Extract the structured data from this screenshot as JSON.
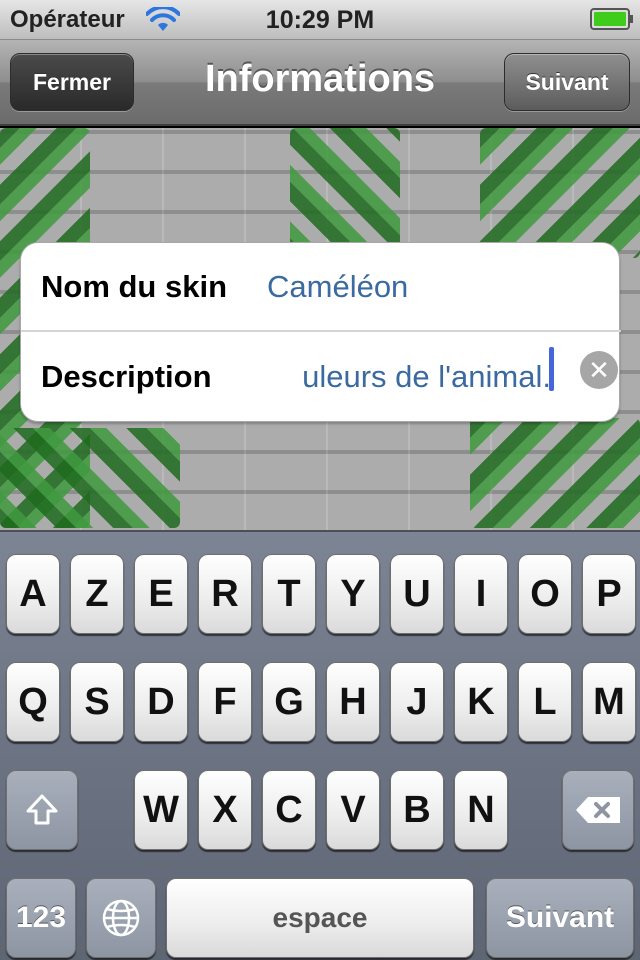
{
  "status_bar": {
    "carrier": "Opérateur",
    "time": "10:29 PM",
    "wifi_icon": "wifi-icon",
    "battery_icon": "battery-icon"
  },
  "nav": {
    "title": "Informations",
    "left_button": "Fermer",
    "right_button": "Suivant"
  },
  "form": {
    "rows": [
      {
        "label": "Nom du skin",
        "value": "Caméléon"
      },
      {
        "label": "Description",
        "value": "uleurs de l'animal.",
        "clear_icon": "clear-circle-icon"
      }
    ]
  },
  "keyboard": {
    "row1": [
      "A",
      "Z",
      "E",
      "R",
      "T",
      "Y",
      "U",
      "I",
      "O",
      "P"
    ],
    "row2": [
      "Q",
      "S",
      "D",
      "F",
      "G",
      "H",
      "J",
      "K",
      "L",
      "M"
    ],
    "row3": [
      "W",
      "X",
      "C",
      "V",
      "B",
      "N"
    ],
    "shift_icon": "shift-icon",
    "backspace_icon": "backspace-icon",
    "globe_icon": "globe-icon",
    "numbers_key": "123",
    "space_key": "espace",
    "return_key": "Suivant"
  },
  "colors": {
    "accent_text": "#3b6aa0",
    "cursor": "#4565d8",
    "battery": "#3fcc1b"
  }
}
